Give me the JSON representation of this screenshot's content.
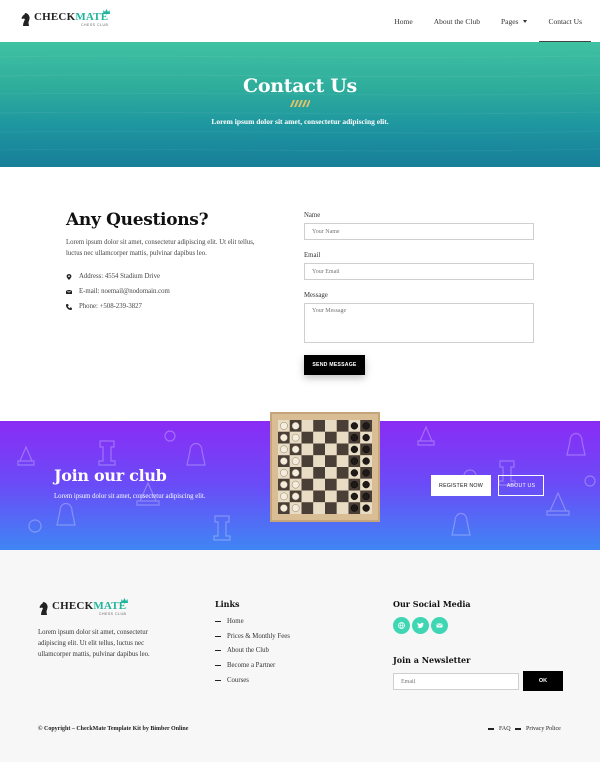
{
  "brand": {
    "check": "CHECK",
    "mate": "MATE",
    "sub": "CHESS CLUB",
    "accent": "#1fb59d"
  },
  "nav": {
    "items": [
      {
        "label": "Home"
      },
      {
        "label": "About the Club"
      },
      {
        "label": "Pages"
      },
      {
        "label": "Contact Us"
      }
    ],
    "active": "Contact Us"
  },
  "hero": {
    "title": "Contact Us",
    "subtitle": "Lorem ipsum dolor sit amet, consectetur adipiscing elit."
  },
  "contact": {
    "heading": "Any Questions?",
    "text": "Lorem ipsum dolor sit amet, consectetur adipiscing elit. Ut elit tellus, luctus nec ullamcorper mattis, pulvinar dapibus leo.",
    "address": "Address: 4554 Stadium Drive",
    "email": "E-mail: noemail@nodomain.com",
    "phone": "Phone: +508-239-3827"
  },
  "form": {
    "name_label": "Name",
    "name_placeholder": "Your Name",
    "email_label": "Email",
    "email_placeholder": "Your Email",
    "message_label": "Message",
    "message_placeholder": "Your Message",
    "submit": "SEND MESSAGE"
  },
  "join": {
    "title": "Join our club",
    "text": "Lorem ipsum dolor sit amet, consectetur adipiscing elit.",
    "register": "REGISTER NOW",
    "about": "ABOUT US"
  },
  "footer": {
    "about": "Lorem ipsum dolor sit amet, consectetur adipiscing elit. Ut elit tellus, luctus nec ullamcorper mattis, pulvinar dapibus leo.",
    "links_title": "Links",
    "links": [
      "Home",
      "Prices & Monthly Fees",
      "About the Club",
      "Become a Partner",
      "Courses"
    ],
    "social_title": "Our Social Media",
    "social_icons": [
      "globe-icon",
      "twitter-icon",
      "mail-icon"
    ],
    "newsletter_title": "Join a Newsletter",
    "newsletter_placeholder": "Email",
    "newsletter_button": "OK",
    "copyright": "© Copyright – CheckMate Template Kit by Bimber Online",
    "bottom_links": [
      "FAQ",
      "Privacy Police"
    ]
  }
}
